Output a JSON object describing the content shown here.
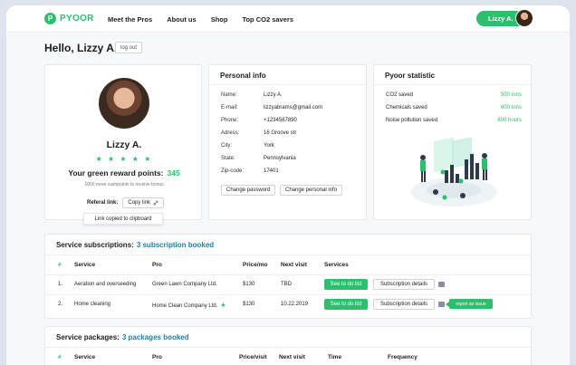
{
  "brand": {
    "name": "PYOOR",
    "mark": "P"
  },
  "nav": {
    "links": [
      "Meet the Pros",
      "About us",
      "Shop",
      "Top CO2 savers"
    ],
    "user_label": "Lizzy A."
  },
  "greeting": {
    "title": "Hello, Lizzy A.",
    "logout_label": "log out"
  },
  "profile": {
    "name": "Lizzy A.",
    "stars": "★ ★ ★ ★ ★",
    "rating": 5,
    "points_label": "Your green reward points:",
    "points": "345",
    "cashpoints_note": "1000 more cashpoints to receive bonus",
    "referral_label": "Referal link:",
    "copy_label": "Copy link",
    "copied_tooltip": "Link copied to clipboard"
  },
  "personal_info": {
    "title": "Personal info",
    "rows": [
      {
        "k": "Name:",
        "v": "Lizzy A."
      },
      {
        "k": "E-mail:",
        "v": "lizzyabrams@gmail.com"
      },
      {
        "k": "Phone:",
        "v": "+1234567890"
      },
      {
        "k": "Adress:",
        "v": "16 Groove str"
      },
      {
        "k": "City:",
        "v": "York"
      },
      {
        "k": "State:",
        "v": "Pennsylvania"
      },
      {
        "k": "Zip-code:",
        "v": "17401"
      }
    ],
    "change_password": "Change password",
    "change_info": "Change personal info"
  },
  "statistic": {
    "title": "Pyoor statistic",
    "rows": [
      {
        "k": "CO2 saved",
        "v": "500 tons"
      },
      {
        "k": "Chemicals saved",
        "v": "600 tons"
      },
      {
        "k": "Noise pollution saved",
        "v": "600 hours"
      }
    ]
  },
  "subscriptions": {
    "title": "Service subscriptions:",
    "count": "3 subscription booked",
    "headers": [
      "#",
      "Service",
      "Pro",
      "Price/mo",
      "Next visit",
      "Services"
    ],
    "rows": [
      {
        "n": "1.",
        "service": "Aeration and overseeding",
        "pro": "Green Lawn Company Ltd.",
        "price": "$130",
        "next": "TBD",
        "todo": "See to do list",
        "details": "Subscription details"
      },
      {
        "n": "2.",
        "service": "Home cleaning",
        "pro": "Home Clean Company Ltd.",
        "price": "$130",
        "next": "10.22.2019",
        "todo": "See to do list",
        "details": "Subscription details",
        "issue": "report an issue"
      }
    ]
  },
  "packages": {
    "title": "Service packages:",
    "count": "3 packages booked",
    "headers": [
      "#",
      "Service",
      "Pro",
      "Price/visit",
      "Next visit",
      "Time",
      "Frequency"
    ]
  },
  "colors": {
    "accent": "#2bbf6e",
    "count": "#1e7fa0",
    "background": "#f7f8fa"
  }
}
